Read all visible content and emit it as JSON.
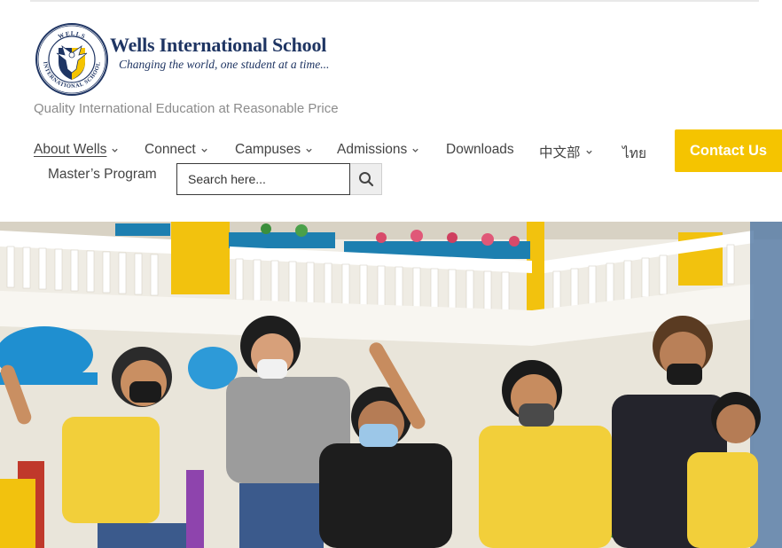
{
  "header": {
    "school_name": "Wells International School",
    "tagline": "Changing the world, one student at a time...",
    "quality_line": "Quality International Education at Reasonable Price",
    "seal_text_top": "WELLS",
    "seal_text_bottom": "INTERNATIONAL SCHOOL"
  },
  "nav": {
    "items": [
      {
        "label": "About Wells",
        "has_dropdown": true,
        "active": true
      },
      {
        "label": "Connect",
        "has_dropdown": true
      },
      {
        "label": "Campuses",
        "has_dropdown": true
      },
      {
        "label": "Admissions",
        "has_dropdown": true
      },
      {
        "label": "Downloads",
        "has_dropdown": false
      },
      {
        "label": "中文部",
        "has_dropdown": true
      },
      {
        "label": "ไทย",
        "has_dropdown": false
      }
    ],
    "masters": "Master’s Program",
    "contact_label": "Contact Us",
    "accent_color": "#f5c400"
  },
  "search": {
    "placeholder": "Search here...",
    "icon": "search-icon"
  },
  "hero": {
    "description_icon": "hero-photo"
  },
  "colors": {
    "brand_navy": "#1f3563",
    "accent_yellow": "#f5c400",
    "text_gray": "#8c8c8c"
  }
}
